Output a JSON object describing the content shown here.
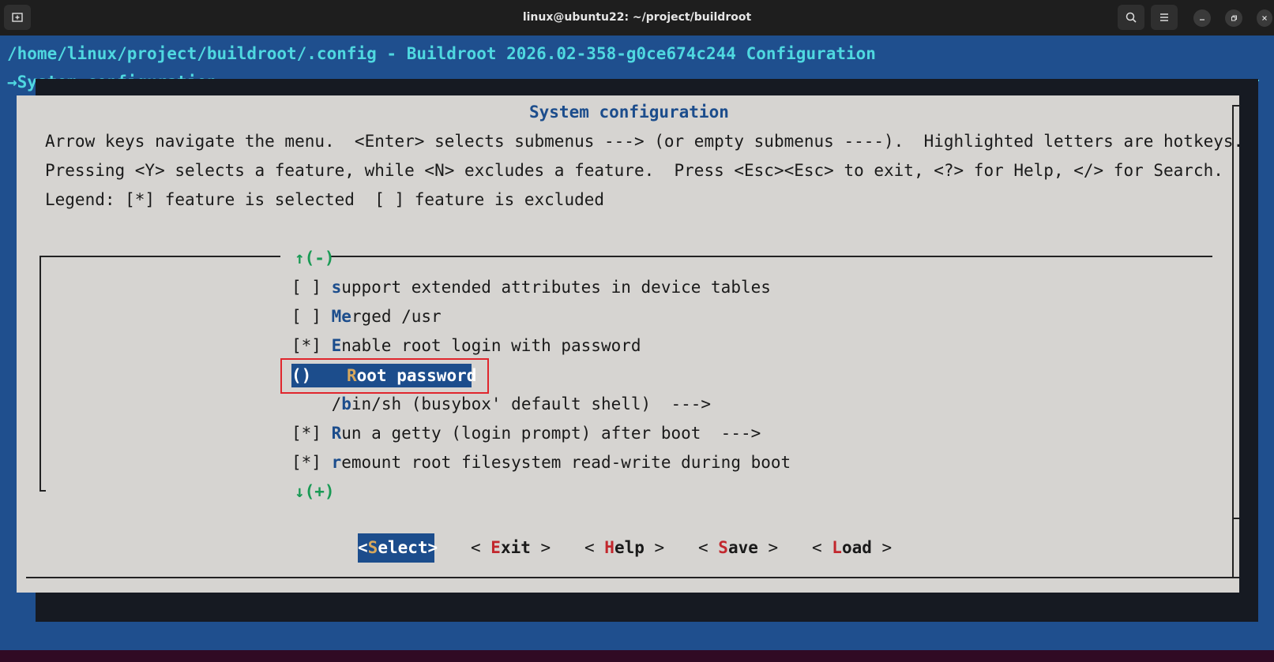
{
  "window": {
    "title": "linux@ubuntu22: ~/project/buildroot"
  },
  "terminal": {
    "header_line": "/home/linux/project/buildroot/.config - Buildroot 2026.02-358-g0ce674c244 Configuration",
    "breadcrumb": "→System configuration"
  },
  "dialog": {
    "title": "System configuration",
    "help_lines": [
      "Arrow keys navigate the menu.  <Enter> selects submenus ---> (or empty submenus ----).  Highlighted letters are hotkeys.",
      "Pressing <Y> selects a feature, while <N> excludes a feature.  Press <Esc><Esc> to exit, <?> for Help, </> for Search.",
      "Legend: [*] feature is selected  [ ] feature is excluded"
    ],
    "scroll_up": "↑(-)",
    "scroll_down": "↓(+)",
    "menu_items": [
      {
        "prefix": "[ ] ",
        "hotkey": "s",
        "rest": "upport extended attributes in device tables"
      },
      {
        "prefix": "[ ] ",
        "hotkey": "M",
        "rest": "e",
        "hotkey2": "r",
        "rest2": "ged /usr"
      },
      {
        "prefix": "[*] ",
        "hotkey": "E",
        "rest": "nable root login with password"
      },
      {
        "prefix": "()",
        "hotkey": "R",
        "rest": "oot password",
        "selected": true
      },
      {
        "prefix": "    ",
        "pre_hotkey": "/",
        "hotkey": "b",
        "rest": "in/sh (busybox' default shell)  --->"
      },
      {
        "prefix": "[*] ",
        "hotkey": "R",
        "rest": "un a getty (login prompt) after boot  --->"
      },
      {
        "prefix": "[*] ",
        "hotkey": "r",
        "rest": "emount root filesystem read-write during boot"
      }
    ],
    "buttons": [
      {
        "open": "<",
        "hotkey": "S",
        "rest": "elect",
        "close": ">",
        "selected": true
      },
      {
        "open": "< ",
        "hotkey": "E",
        "rest": "xit",
        "close": " >"
      },
      {
        "open": "< ",
        "hotkey": "H",
        "rest": "elp",
        "close": " >"
      },
      {
        "open": "< ",
        "hotkey": "S",
        "rest": "ave",
        "close": " >"
      },
      {
        "open": "< ",
        "hotkey": "L",
        "rest": "oad",
        "close": " >"
      }
    ]
  },
  "icons": {
    "new_tab": "new-tab-icon",
    "search": "search-icon",
    "menu": "hamburger-menu-icon",
    "minimize": "minimize-icon",
    "restore": "restore-icon",
    "close": "close-icon"
  }
}
